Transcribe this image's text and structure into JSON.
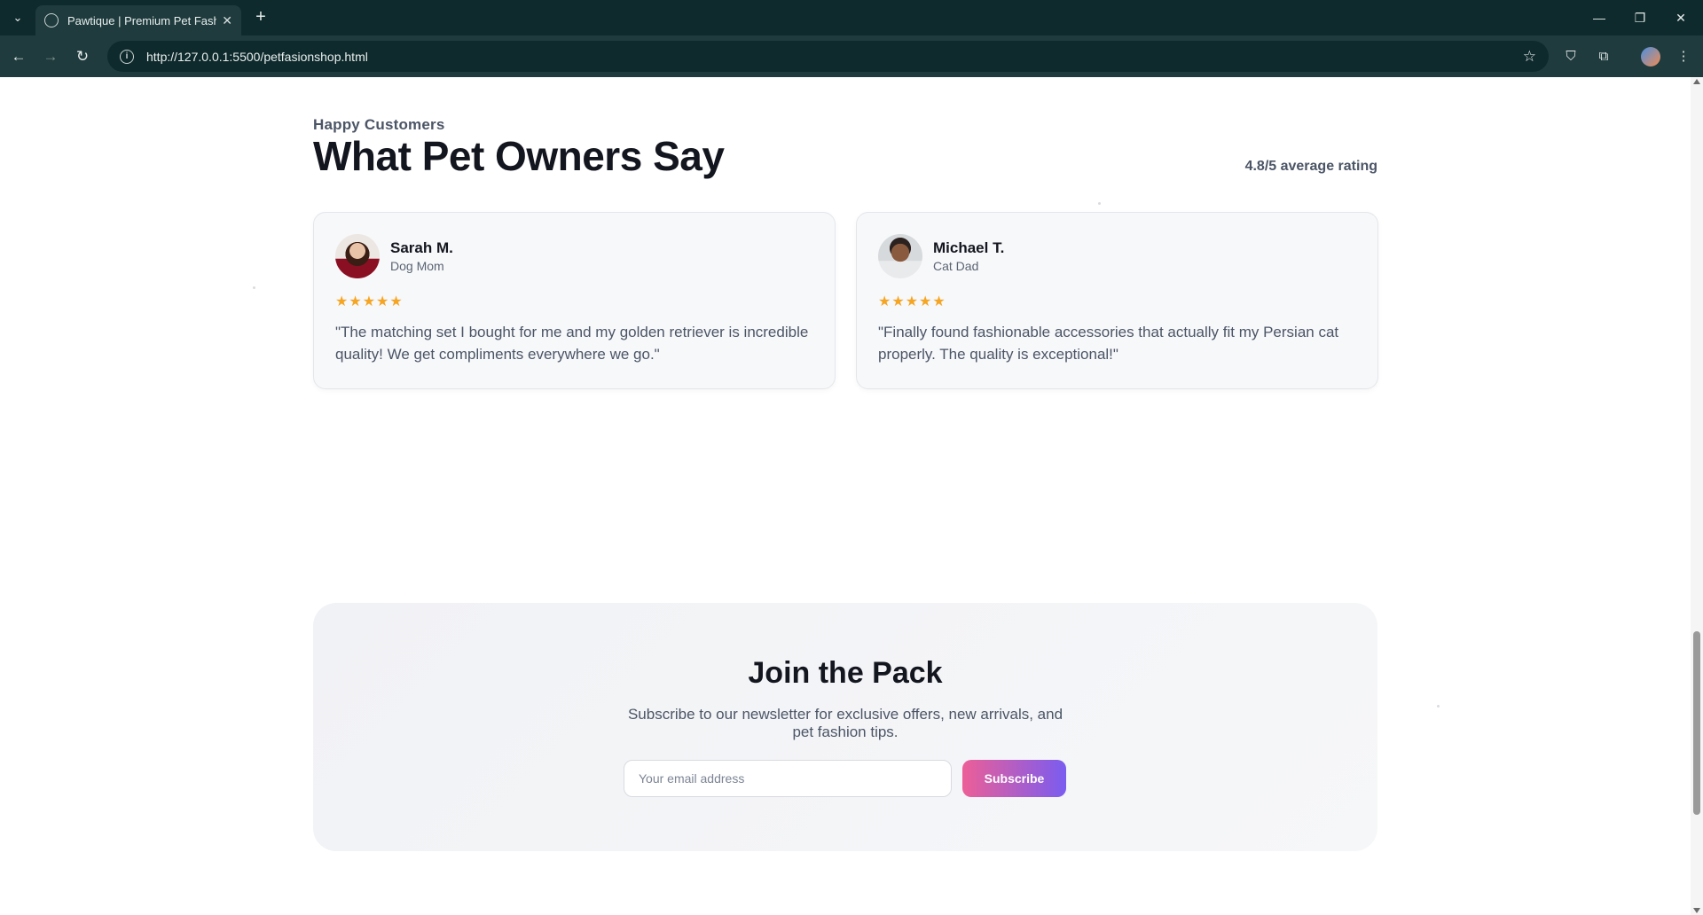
{
  "browser": {
    "tab_title": "Pawtique | Premium Pet Fashion",
    "url": "http://127.0.0.1:5500/petfasionshop.html",
    "icons": {
      "tab_menu": "chevron-down-icon",
      "new_tab": "plus-icon",
      "back": "arrow-left-icon",
      "forward": "arrow-right-icon",
      "reload": "reload-icon",
      "site_info": "info-icon",
      "bookmark": "star-icon",
      "shield": "shield-icon",
      "extensions": "puzzle-icon",
      "menu": "kebab-menu-icon"
    }
  },
  "testimonials": {
    "eyebrow": "Happy Customers",
    "title": "What Pet Owners Say",
    "rating": "4.8/5 average rating",
    "rating_value": 4.8,
    "reviews": [
      {
        "name": "Sarah M.",
        "role": "Dog Mom",
        "stars": "★★★★★",
        "star_count": 5,
        "quote": "\"The matching set I bought for me and my golden retriever is incredible quality! We get compliments everywhere we go.\""
      },
      {
        "name": "Michael T.",
        "role": "Cat Dad",
        "stars": "★★★★★",
        "star_count": 5,
        "quote": "\"Finally found fashionable accessories that actually fit my Persian cat properly. The quality is exceptional!\""
      }
    ]
  },
  "newsletter": {
    "title": "Join the Pack",
    "description": "Subscribe to our newsletter for exclusive offers, new arrivals, and pet fashion tips.",
    "email_placeholder": "Your email address",
    "subscribe_label": "Subscribe"
  },
  "colors": {
    "accent_gradient_start": "#ec5f97",
    "accent_gradient_end": "#7a5cf0",
    "star": "#f5a524",
    "heading": "#14161f"
  }
}
